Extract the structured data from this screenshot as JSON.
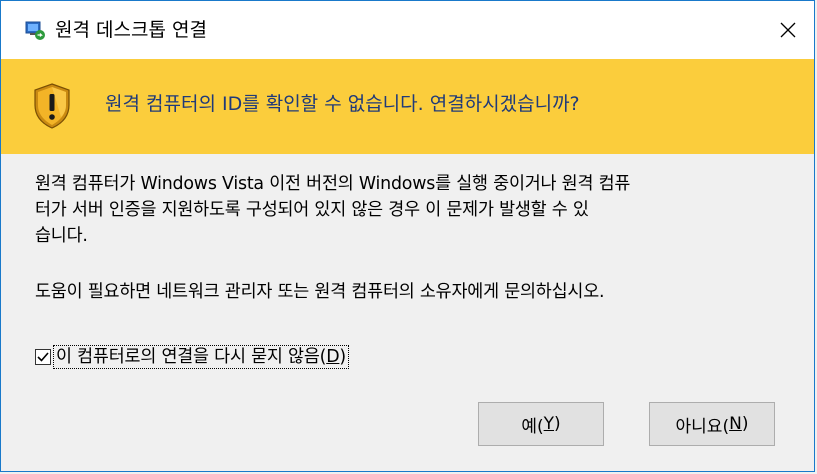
{
  "window": {
    "title": "원격 데스크톱 연결",
    "close_icon": "close-icon",
    "app_icon": "remote-desktop-icon"
  },
  "banner": {
    "icon": "warning-shield-icon",
    "message": "원격 컴퓨터의 ID를 확인할 수 없습니다. 연결하시겠습니까?",
    "background": "#fbcd3c",
    "text_color": "#1f3a7a"
  },
  "body": {
    "line1": "원격 컴퓨터가 Windows Vista 이전 버전의 Windows를 실행 중이거나 원격 컴퓨",
    "line2": "터가 서버 인증을 지원하도록 구성되어 있지 않은 경우 이 문제가 발생할 수 있",
    "line3": "습니다.",
    "help": "도움이 필요하면 네트워크 관리자 또는 원격 컴퓨터의 소유자에게 문의하십시오."
  },
  "checkbox": {
    "label_main": "이 컴퓨터로의 연결을 다시 묻지 않음(",
    "label_key": "D",
    "label_end": ")",
    "checked": true
  },
  "buttons": {
    "yes_main": "예(",
    "yes_key": "Y",
    "yes_end": ")",
    "no_main": "아니요(",
    "no_key": "N",
    "no_end": ")"
  }
}
